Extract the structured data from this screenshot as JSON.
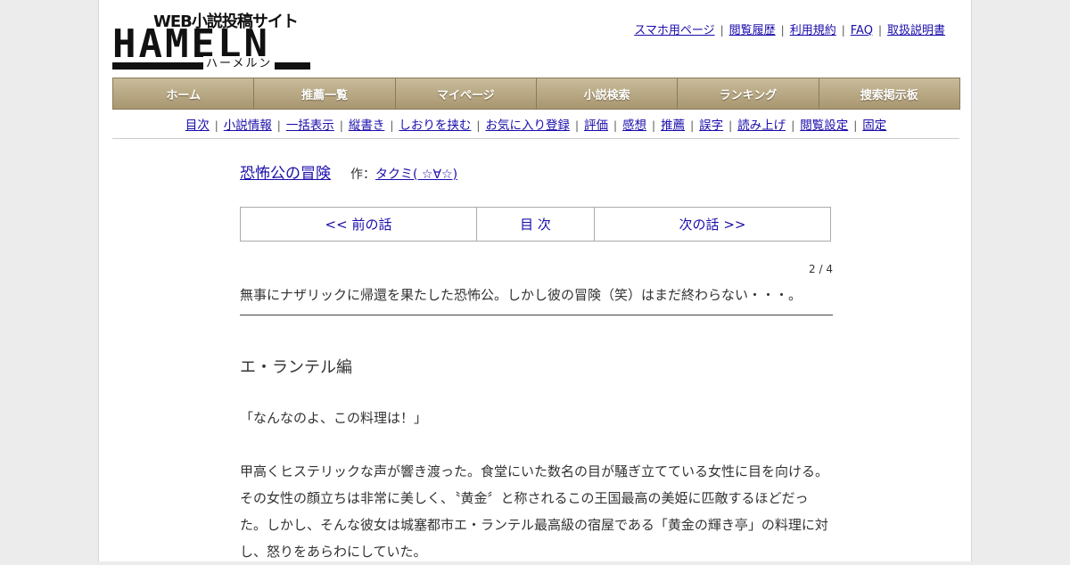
{
  "logo": {
    "tagline": "WEB小説投稿サイト",
    "word": "HAMELN",
    "kana": "ハーメルン"
  },
  "top_links": [
    "スマホ用ページ",
    "閲覧履歴",
    "利用規約",
    "FAQ",
    "取扱説明書"
  ],
  "main_nav": [
    "ホーム",
    "推薦一覧",
    "マイページ",
    "小説検索",
    "ランキング",
    "捜索掲示板"
  ],
  "sub_nav": [
    "目次",
    "小説情報",
    "一括表示",
    "縦書き",
    "しおりを挟む",
    "お気に入り登録",
    "評価",
    "感想",
    "推薦",
    "誤字",
    "読み上げ",
    "閲覧設定",
    "固定"
  ],
  "novel": {
    "title": "恐怖公の冒険",
    "author_prefix": "作：",
    "author": "タクミ( ☆∀☆)"
  },
  "pager": {
    "prev": "<< 前の話",
    "toc": "目 次",
    "next": "次の話 >>"
  },
  "episode_count": "2 / 4",
  "preface": "無事にナザリックに帰還を果たした恐怖公。しかし彼の冒険（笑）はまだ終わらない・・・。",
  "chapter_title": "エ・ランテル編",
  "paragraphs": [
    "「なんなのよ、この料理は！」",
    "甲高くヒステリックな声が響き渡った。食堂にいた数名の目が騒ぎ立てている女性に目を向ける。その女性の顔立ちは非常に美しく、〝黄金〞と称されるこの王国最高の美姫に匹敵するほどだった。しかし、そんな彼女は城塞都市エ・ランテル最高級の宿屋である「黄金の輝き亭」の料理に対し、怒りをあらわにしていた。"
  ],
  "colors": {
    "link": "#1a0dab",
    "nav_bg": "#b3a37f",
    "page_bg": "#ececec"
  }
}
